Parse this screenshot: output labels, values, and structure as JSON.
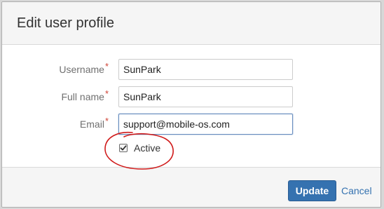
{
  "dialog": {
    "title": "Edit user profile"
  },
  "form": {
    "required_marker": "*",
    "username": {
      "label": "Username",
      "value": "SunPark"
    },
    "fullname": {
      "label": "Full name",
      "value": "SunPark"
    },
    "email": {
      "label": "Email",
      "value": "support@mobile-os.com"
    },
    "active": {
      "label": "Active",
      "checked": true
    }
  },
  "footer": {
    "update_label": "Update",
    "cancel_label": "Cancel"
  },
  "colors": {
    "primary": "#3572b0",
    "required": "#d04437",
    "annotation": "#d01a1a"
  },
  "icons": {
    "checkbox": "checkmark-icon"
  }
}
